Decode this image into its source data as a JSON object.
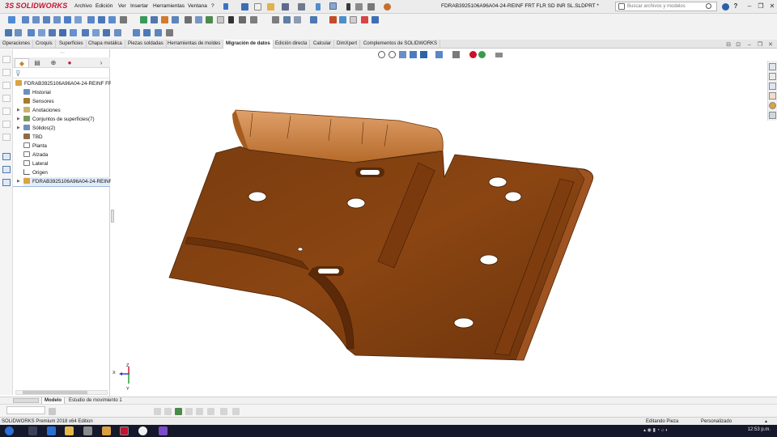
{
  "app": {
    "logo_text_ds": "3S",
    "logo_text": "SOLIDWORKS",
    "menu": [
      "Archivo",
      "Edición",
      "Ver",
      "Insertar",
      "Herramientas",
      "Ventana",
      "?"
    ],
    "document_title": "FDRAB3925106A96A04-24-REINF FRT FLR SD INR SL.SLDPRT *",
    "search_placeholder": "Buscar archivos y modelos",
    "window_buttons": [
      "–",
      "❐",
      "✕"
    ],
    "accent_color": "#c8102e"
  },
  "command_tabs": [
    "Operaciones",
    "Croquis",
    "Superficies",
    "Chapa metálica",
    "Piezas soldadas",
    "Herramientas de moldes",
    "Migración de datos",
    "Edición directa",
    "Calcular",
    "DimXpert",
    "Complementos de SOLIDWORKS"
  ],
  "active_command_tab": "Migración de datos",
  "feature_tree": {
    "root": "FDRAB3925106A96A04-24-REINF FRT FL",
    "items": [
      {
        "label": "Historial",
        "icon": "history-icon"
      },
      {
        "label": "Sensores",
        "icon": "sensor-icon"
      },
      {
        "label": "Anotaciones",
        "icon": "annotation-icon"
      },
      {
        "label": "Conjuntos de superficies(7)",
        "icon": "surface-icon"
      },
      {
        "label": "Sólidos(2)",
        "icon": "solid-icon"
      },
      {
        "label": "TBD",
        "icon": "material-icon"
      },
      {
        "label": "Planta",
        "icon": "plane-icon"
      },
      {
        "label": "Alzada",
        "icon": "plane-icon"
      },
      {
        "label": "Lateral",
        "icon": "plane-icon"
      },
      {
        "label": "Origen",
        "icon": "origin-icon"
      }
    ],
    "selected_feature": "FDRAB3925106A96A04-24-REINF FRT"
  },
  "bottom_tabs": [
    "Modelo",
    "Estudio de movimiento 1"
  ],
  "active_bottom_tab": "Modelo",
  "status": {
    "left": "SOLIDWORKS Premium 2018 x64 Edition",
    "mode": "Editando Pieza",
    "custom": "Personalizado",
    "clock": "12:53 p.m."
  },
  "model_color": "#8a4512",
  "triad": {
    "x": "X",
    "y": "Y",
    "z": "Z"
  }
}
